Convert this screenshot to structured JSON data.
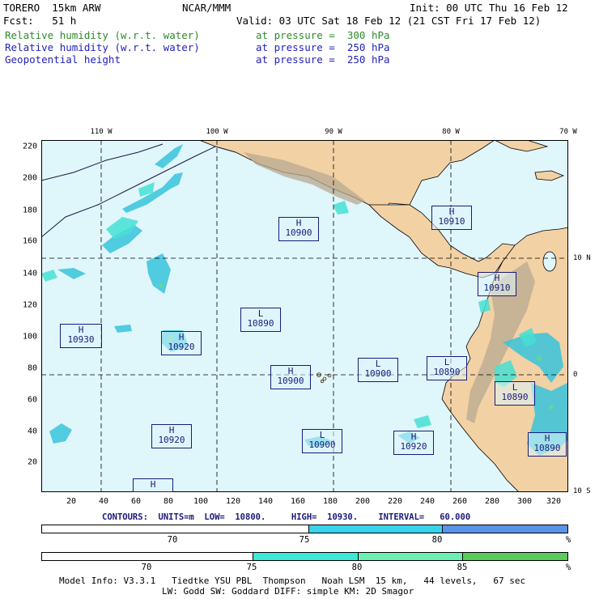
{
  "header": {
    "model": "TORERO  15km ARW",
    "center": "NCAR/MMM",
    "init": "Init: 00 UTC Thu 16 Feb 12",
    "fcst": "Fcst:   51 h",
    "valid": "Valid: 03 UTC Sat 18 Feb 12 (21 CST Fri 17 Feb 12)",
    "fields": [
      {
        "name": "Relative humidity (w.r.t. water)",
        "level": "at pressure =  300 hPa",
        "color": "#2e8b2e"
      },
      {
        "name": "Relative humidity (w.r.t. water)",
        "level": "at pressure =  250 hPa",
        "color": "#2222bb"
      },
      {
        "name": "Geopotential height",
        "level": "at pressure =  250 hPa",
        "color": "#2222bb"
      }
    ]
  },
  "map": {
    "x_ticks": [
      "20",
      "40",
      "60",
      "80",
      "100",
      "120",
      "140",
      "160",
      "180",
      "200",
      "220",
      "240",
      "260",
      "280",
      "300",
      "320"
    ],
    "y_ticks": [
      "20",
      "40",
      "60",
      "80",
      "100",
      "120",
      "140",
      "160",
      "180",
      "200",
      "220"
    ],
    "lon_labels": [
      "110 W",
      "100 W",
      "90 W",
      "80 W",
      "70 W"
    ],
    "lat_labels": [
      "10 N",
      "0",
      "10 S"
    ],
    "colors": {
      "ocean": "#dff6fb",
      "land": "#f2d1a4",
      "mountain": "#b8a890",
      "grid": "#000000",
      "rh300": "#47e0d4",
      "rh250": "#38c4dc",
      "contour": "#1a1a7a"
    },
    "centers": [
      {
        "letter": "H",
        "value": "10900"
      },
      {
        "letter": "H",
        "value": "10910"
      },
      {
        "letter": "H",
        "value": "10910"
      },
      {
        "letter": "L",
        "value": "10890"
      },
      {
        "letter": "H",
        "value": "10930"
      },
      {
        "letter": "H",
        "value": "10920"
      },
      {
        "letter": "H",
        "value": "10900"
      },
      {
        "letter": "L",
        "value": "10900"
      },
      {
        "letter": "L",
        "value": "10890"
      },
      {
        "letter": "L",
        "value": "10890"
      },
      {
        "letter": "H",
        "value": "10920"
      },
      {
        "letter": "L",
        "value": "10900"
      },
      {
        "letter": "H",
        "value": "10920"
      },
      {
        "letter": "H",
        "value": "10890"
      },
      {
        "letter": "H",
        "value": ""
      }
    ]
  },
  "contour_info": "CONTOURS:  UNITS=m  LOW=  10800.     HIGH=  10930.    INTERVAL=   60.000",
  "colorbar_250": {
    "segments": [
      "#ffffff",
      "#38d4ec",
      "#5a94e8"
    ],
    "labels": [
      "70",
      "75",
      "80",
      "%"
    ]
  },
  "colorbar_300": {
    "segments": [
      "#ffffff",
      "#3ee8d8",
      "#6af0b0",
      "#5acc5a"
    ],
    "labels": [
      "70",
      "75",
      "80",
      "85",
      "%"
    ]
  },
  "footer": {
    "line1": "Model Info: V3.3.1   Tiedtke YSU PBL  Thompson   Noah LSM  15 km,   44 levels,   67 sec",
    "line2": "LW: Godd SW: Goddard DIFF: simple KM: 2D Smagor"
  }
}
